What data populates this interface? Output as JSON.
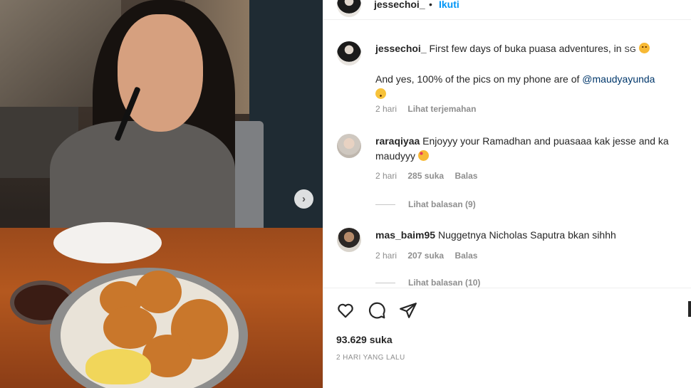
{
  "header": {
    "username": "jessechoi_",
    "separator": "•",
    "follow_label": "Ikuti"
  },
  "caption": {
    "username": "jessechoi_",
    "text_line1": "First few days of buka puasa adventures, in",
    "place_tag": "SG",
    "text_line2_prefix": "And yes, 100% of the pics on my phone are of",
    "mention": "@maudyayunda",
    "age": "2 hari",
    "translate_label": "Lihat terjemahan"
  },
  "comments": [
    {
      "username": "raraqiyaa",
      "text": "Enjoyyy your Ramadhan and puasaaa kak jesse and ka maudyyy",
      "age": "2 hari",
      "likes": "285 suka",
      "reply_label": "Balas",
      "view_replies": "Lihat balasan (9)"
    },
    {
      "username": "mas_baim95",
      "text": "Nuggetnya Nicholas Saputra bkan sihhh",
      "age": "2 hari",
      "likes": "207 suka",
      "reply_label": "Balas",
      "view_replies": "Lihat balasan (10)"
    }
  ],
  "footer": {
    "likes_count": "93.629 suka",
    "timestamp": "2 HARI YANG LALU"
  },
  "icons": {
    "like": "heart-icon",
    "comment": "comment-icon",
    "share": "share-icon",
    "next": "chevron-right-icon"
  },
  "colors": {
    "accent": "#0095f6",
    "text": "#262626",
    "muted": "#8e8e8e",
    "mention": "#00376b"
  }
}
